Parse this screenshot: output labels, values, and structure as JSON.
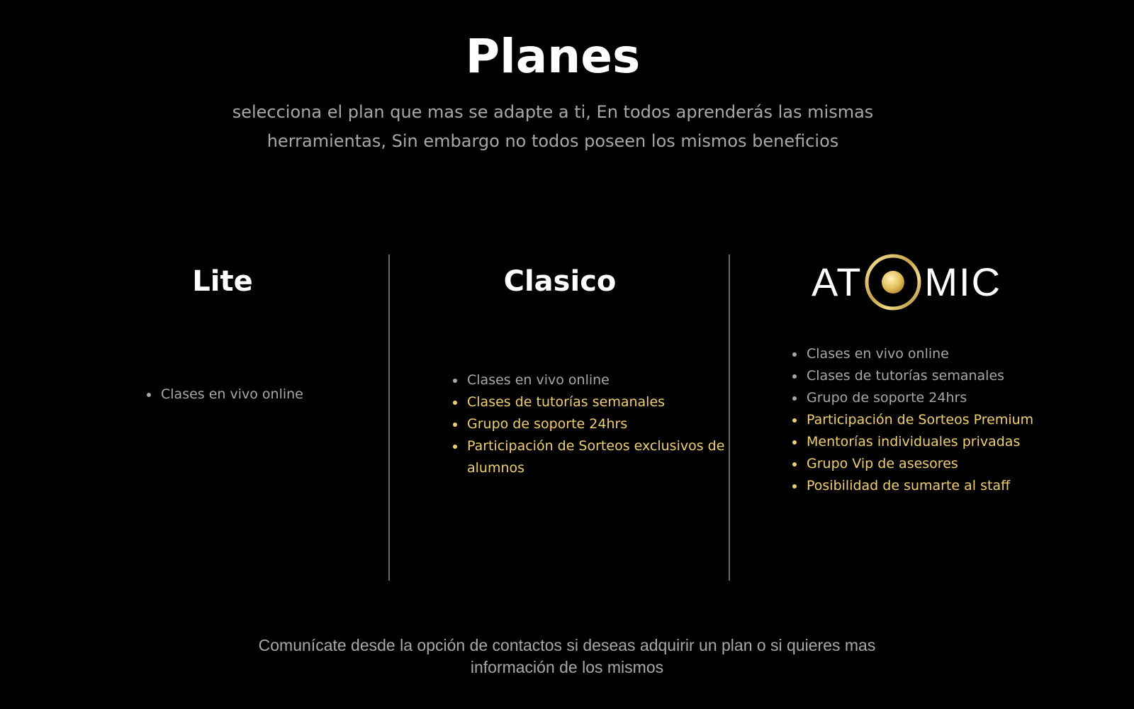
{
  "header": {
    "title": "Planes",
    "subtitle": "selecciona el plan que mas se adapte a ti, En todos aprenderás las mismas herramientas, Sin embargo no todos poseen los mismos beneficios"
  },
  "plans": [
    {
      "name": "Lite",
      "features": [
        {
          "label": "Clases en vivo online",
          "tier": "basic"
        }
      ]
    },
    {
      "name": "Clasico",
      "features": [
        {
          "label": "Clases en vivo online",
          "tier": "basic"
        },
        {
          "label": "Clases de tutorías semanales",
          "tier": "premium"
        },
        {
          "label": "Grupo de soporte 24hrs",
          "tier": "premium"
        },
        {
          "label": "Participación de Sorteos exclusivos de alumnos",
          "tier": "premium"
        }
      ]
    },
    {
      "name": "ATOMIC",
      "logo": {
        "left_text": "AT",
        "right_text": "MIC",
        "ring_icon": "gold-ring-icon"
      },
      "features": [
        {
          "label": "Clases en vivo online",
          "tier": "basic"
        },
        {
          "label": "Clases de tutorías semanales",
          "tier": "basic"
        },
        {
          "label": "Grupo de soporte 24hrs",
          "tier": "basic"
        },
        {
          "label": "Participación de Sorteos Premium",
          "tier": "premium"
        },
        {
          "label": "Mentorías individuales privadas",
          "tier": "premium"
        },
        {
          "label": "Grupo Vip de asesores",
          "tier": "premium"
        },
        {
          "label": "Posibilidad de sumarte al staff",
          "tier": "premium"
        }
      ]
    }
  ],
  "footer": {
    "text": "Comunícate desde la opción de contactos si deseas adquirir un plan o si quieres mas información de los mismos"
  },
  "colors": {
    "background": "#000000",
    "heading": "#ffffff",
    "basic_text": "#a8a8a8",
    "premium_text": "#efcf6e",
    "divider": "#6a6a6a"
  }
}
